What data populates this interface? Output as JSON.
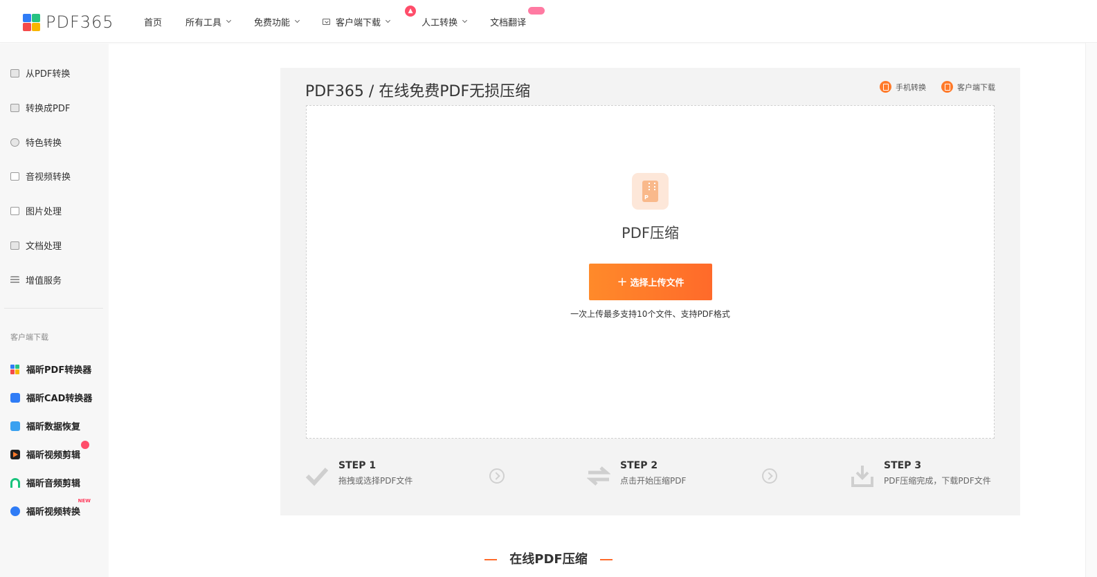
{
  "logo": {
    "text": "PDF365",
    "colors": [
      "#2f7cf6",
      "#f44a4a",
      "#f7b500",
      "#26c281"
    ]
  },
  "nav": {
    "home": "首页",
    "all_tools": "所有工具",
    "free_features": "免费功能",
    "client_download": "客户端下载",
    "manual_convert": "人工转换",
    "doc_translate": "文档翻译"
  },
  "sidebar": {
    "items": [
      {
        "label": "从PDF转换",
        "icon": "from-pdf-icon"
      },
      {
        "label": "转换成PDF",
        "icon": "to-pdf-icon"
      },
      {
        "label": "特色转换",
        "icon": "shield-icon"
      },
      {
        "label": "音视频转换",
        "icon": "media-icon"
      },
      {
        "label": "图片处理",
        "icon": "image-icon"
      },
      {
        "label": "文档处理",
        "icon": "document-icon"
      },
      {
        "label": "增值服务",
        "icon": "list-icon"
      }
    ],
    "section_label": "客户端下载",
    "apps": [
      {
        "label": "福昕PDF转换器",
        "color": "#2f7cf6"
      },
      {
        "label": "福昕CAD转换器",
        "color": "#2f7cf6"
      },
      {
        "label": "福昕数据恢复",
        "color": "#3aa1f0"
      },
      {
        "label": "福昕视频剪辑",
        "color": "#222222"
      },
      {
        "label": "福昕音频剪辑",
        "color": "#19c37d"
      },
      {
        "label": "福昕视频转换",
        "color": "#2f7cf6"
      }
    ],
    "new_badge": "NEW"
  },
  "main": {
    "title": "PDF365 / 在线免费PDF无损压缩",
    "mobile_convert": "手机转换",
    "client_download": "客户端下载",
    "tool_name": "PDF压缩",
    "upload_button": "选择上传文件",
    "upload_hint": "一次上传最多支持10个文件、支持PDF格式"
  },
  "steps": [
    {
      "title": "STEP 1",
      "desc": "拖拽或选择PDF文件",
      "icon": "check-icon"
    },
    {
      "title": "STEP 2",
      "desc": "点击开始压缩PDF",
      "icon": "swap-arrows-icon"
    },
    {
      "title": "STEP 3",
      "desc": "PDF压缩完成，下载PDF文件",
      "icon": "download-tray-icon"
    }
  ],
  "section": {
    "title": "在线PDF压缩"
  },
  "colors": {
    "accent": "#ff6a2a",
    "card_bg": "#f3f3f3",
    "sidebar_bg": "#f7f7f7"
  }
}
